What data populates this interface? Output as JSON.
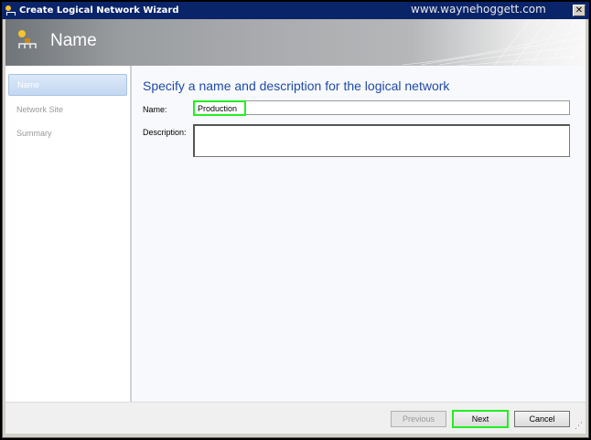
{
  "window": {
    "title": "Create Logical Network Wizard",
    "watermark": "www.waynehoggett.com",
    "close_label": "✕"
  },
  "header": {
    "title": "Name"
  },
  "sidebar": {
    "items": [
      {
        "label": "Name"
      },
      {
        "label": "Network Site"
      },
      {
        "label": "Summary"
      }
    ]
  },
  "content": {
    "heading": "Specify a name and description for the logical network",
    "name_label": "Name:",
    "name_value": "Production",
    "description_label": "Description:",
    "description_value": ""
  },
  "footer": {
    "previous": "Previous",
    "next": "Next",
    "cancel": "Cancel"
  }
}
